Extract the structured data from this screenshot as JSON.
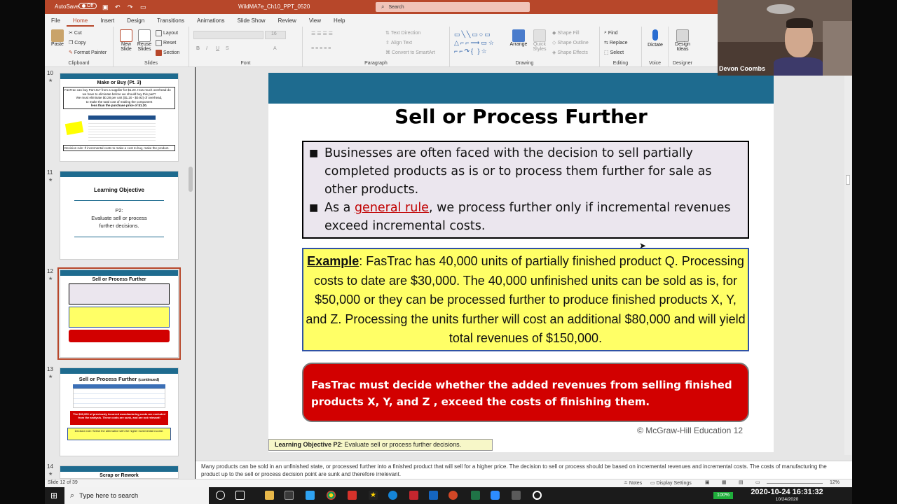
{
  "window": {
    "autosave_label": "AutoSave",
    "autosave_state": "Off",
    "file_title": "WildMA7e_Ch10_PPT_0520",
    "search_placeholder": "Search"
  },
  "tabs": [
    "File",
    "Home",
    "Insert",
    "Design",
    "Transitions",
    "Animations",
    "Slide Show",
    "Review",
    "View",
    "Help"
  ],
  "active_tab": "Home",
  "ribbon": {
    "clipboard": {
      "paste": "Paste",
      "cut": "Cut",
      "copy": "Copy",
      "format_painter": "Format Painter",
      "label": "Clipboard"
    },
    "slides": {
      "new_slide_1": "New",
      "new_slide_2": "Slide",
      "reuse_1": "Reuse",
      "reuse_2": "Slides",
      "layout": "Layout",
      "reset": "Reset",
      "section": "Section",
      "label": "Slides"
    },
    "font": {
      "label": "Font",
      "size": "16",
      "buttons": [
        "B",
        "I",
        "U",
        "S"
      ]
    },
    "paragraph": {
      "text_direction": "Text Direction",
      "align_text": "Align Text",
      "convert_smartart": "Convert to SmartArt",
      "label": "Paragraph"
    },
    "drawing": {
      "arrange": "Arrange",
      "quick_styles_1": "Quick",
      "quick_styles_2": "Styles",
      "shape_fill": "Shape Fill",
      "shape_outline": "Shape Outline",
      "shape_effects": "Shape Effects",
      "label": "Drawing"
    },
    "editing": {
      "find": "Find",
      "replace": "Replace",
      "select": "Select",
      "label": "Editing"
    },
    "voice": {
      "dictate": "Dictate",
      "label": "Voice"
    },
    "designer": {
      "design_ideas_1": "Design",
      "design_ideas_2": "Ideas",
      "label": "Designer"
    }
  },
  "thumbnails": [
    {
      "number": "10",
      "title": "Make or Buy (Pt. 3)",
      "line1": "FasTrac can buy Part 417 from a supplier for $1.20. How much overhead do",
      "line2": "we have to eliminate before we should buy this part?",
      "line3": "We must eliminate $0.28 per unit ($1.20 - $0.92) of overhead,",
      "line4": "to make the total cost of making the component",
      "line5": "less than the purchase price of $1.20.",
      "footer": "Decision rule: If incremental costs to make ≤ cost to buy, make the product."
    },
    {
      "number": "11",
      "title": "Learning Objective",
      "subtitle_1": "P2:",
      "subtitle_2": "Evaluate sell or process",
      "subtitle_3": "further decisions."
    },
    {
      "number": "12",
      "title": "Sell or Process Further"
    },
    {
      "number": "13",
      "title": "Sell or Process Further",
      "title_suffix": "(continued)",
      "red_note": "The $30,000 of previously incurred manufacturing costs are excluded from the analysis. These costs are sunk, and are not relevant!",
      "decision": "Decision rule: Select the alternative with the higher incremental income."
    },
    {
      "number": "14",
      "title": "Scrap or Rework"
    }
  ],
  "slide": {
    "title": "Sell or Process Further",
    "bullet1": "Businesses are often faced with the decision to sell partially completed products as is or to process  them further for sale as other products.",
    "bullet2_pre": "As a ",
    "bullet2_link": "general rule",
    "bullet2_post": ", we process further only if incremental revenues exceed incremental costs.",
    "example_label": "Example",
    "example_text": ": FasTrac has 40,000 units of partially finished product Q. Processing costs to date are $30,000.  The 40,000 unfinished units can be sold as is, for $50,000 or they can be processed further to produce finished products X, Y, and Z. Processing the units further will cost an additional $80,000 and will yield total revenues of $150,000.",
    "red_box": "FasTrac must decide whether the added revenues from selling finished products X, Y, and Z , exceed the costs of finishing them.",
    "copyright": "© McGraw-Hill Education 12",
    "lo_label": "Learning Objective P2",
    "lo_text": ": Evaluate sell or process further decisions."
  },
  "notes": "Many products can be sold in an unfinished state, or processed further into a finished product that will sell for a higher price.  The decision to sell or process should be based on incremental revenues and incremental costs.  The costs of manufacturing the product up to the sell or process decision point are sunk and therefore irrelevant.",
  "status": {
    "slide_indicator": "Slide 12 of 39",
    "notes_button": "Notes",
    "display_settings": "Display Settings",
    "zoom": "12%"
  },
  "taskbar": {
    "search_placeholder": "Type here to search",
    "battery": "100%",
    "time": "2020-10-24  16:31:32",
    "date": "10/24/2020"
  },
  "webcam": {
    "name": "Devon Coombs"
  }
}
